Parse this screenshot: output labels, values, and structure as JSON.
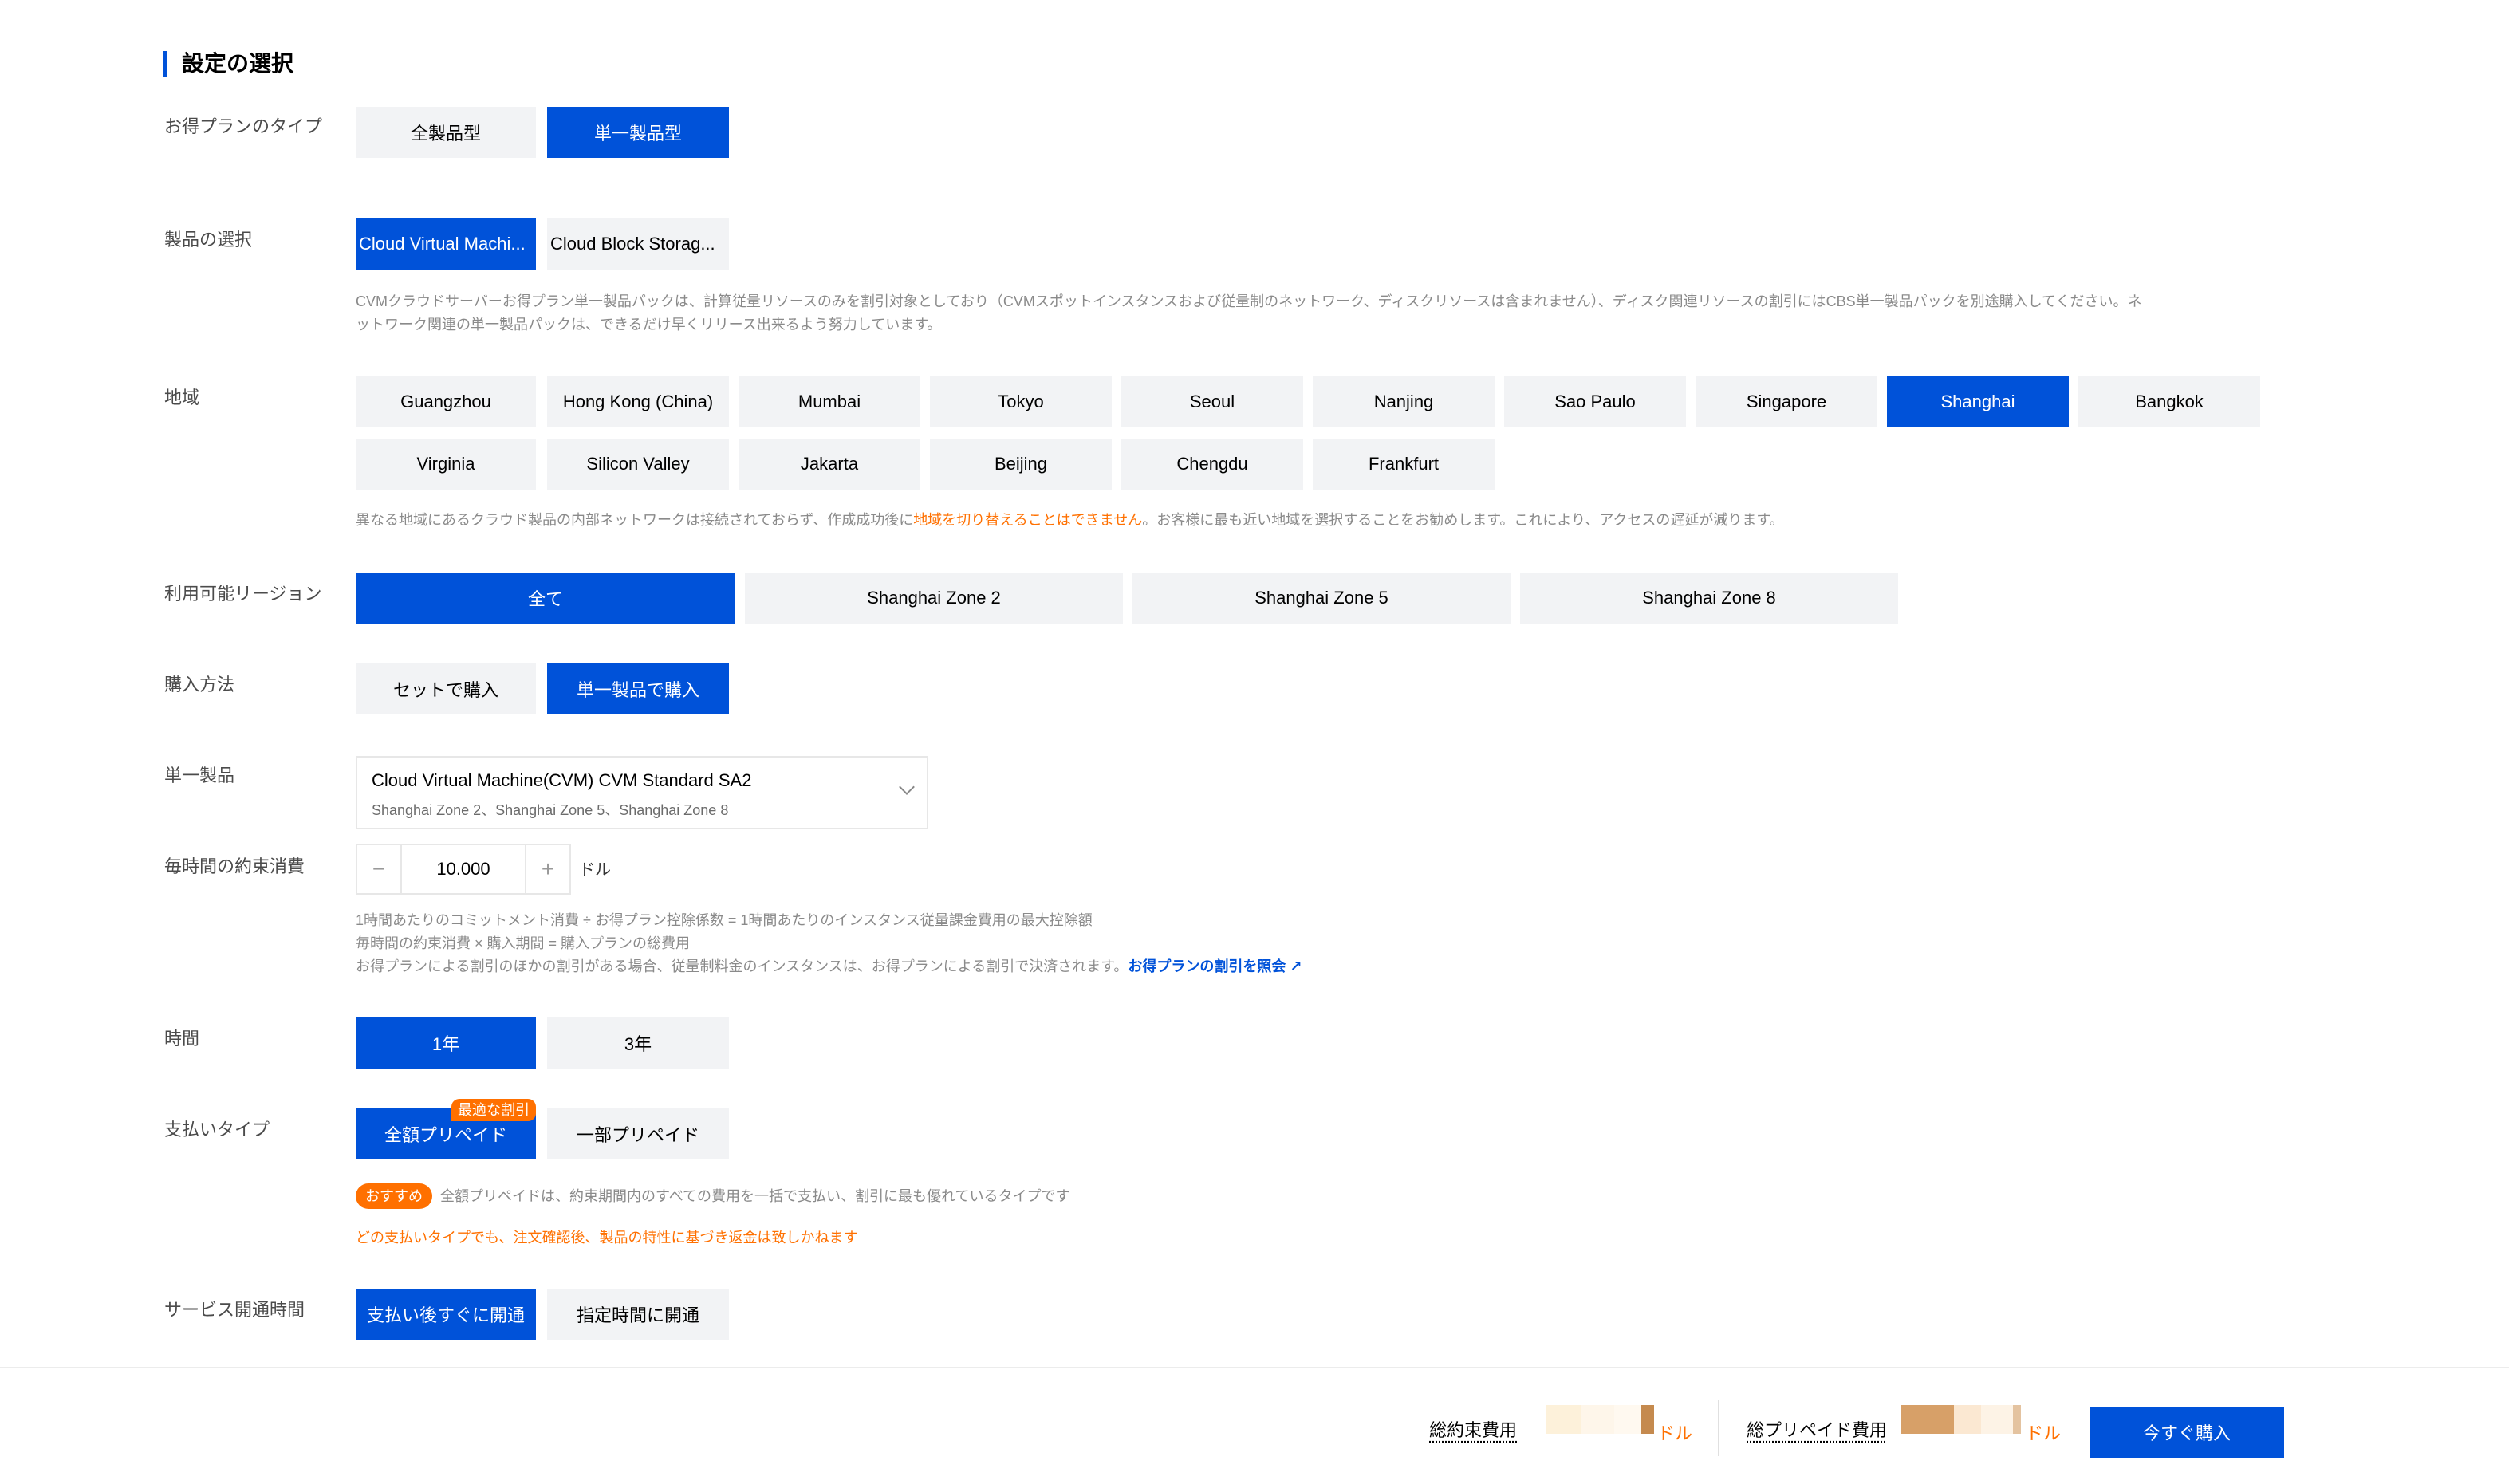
{
  "section": {
    "title": "設定の選択"
  },
  "plan_type": {
    "label": "お得プランのタイプ",
    "options": [
      "全製品型",
      "単一製品型"
    ],
    "selected": 1
  },
  "product": {
    "label": "製品の選択",
    "options": [
      "Cloud Virtual Machi...",
      "Cloud Block Storag..."
    ],
    "selected": 0,
    "note_line1": "CVMクラウドサーバーお得プラン単一製品パックは、計算従量リソースのみを割引対象としており（CVMスポットインスタンスおよび従量制のネットワーク、ディスクリソースは含まれません）、ディスク関連リソースの割引にはCBS単一製品パックを別途購入してください。ネ",
    "note_line2": "ットワーク関連の単一製品パックは、できるだけ早くリリース出来るよう努力しています。"
  },
  "region": {
    "label": "地域",
    "options": [
      "Guangzhou",
      "Hong Kong (China)",
      "Mumbai",
      "Tokyo",
      "Seoul",
      "Nanjing",
      "Sao Paulo",
      "Singapore",
      "Shanghai",
      "Bangkok",
      "Virginia",
      "Silicon Valley",
      "Jakarta",
      "Beijing",
      "Chengdu",
      "Frankfurt"
    ],
    "selected": 8,
    "note_pre": "異なる地域にあるクラウド製品の内部ネットワークは接続されておらず、作成成功後に",
    "note_highlight": "地域を切り替えることはできません",
    "note_post": "。お客様に最も近い地域を選択することをお勧めします。これにより、アクセスの遅延が減ります。"
  },
  "zone": {
    "label": "利用可能リージョン",
    "options": [
      "全て",
      "Shanghai Zone 2",
      "Shanghai Zone 5",
      "Shanghai Zone 8"
    ],
    "selected": 0
  },
  "purchase_method": {
    "label": "購入方法",
    "options": [
      "セットで購入",
      "単一製品で購入"
    ],
    "selected": 1
  },
  "single_product": {
    "label": "単一製品",
    "value": "Cloud Virtual Machine(CVM) CVM Standard SA2",
    "sub": "Shanghai Zone 2、Shanghai Zone 5、Shanghai Zone 8"
  },
  "hourly": {
    "label": "毎時間の約束消費",
    "minus": "−",
    "value": "10.000",
    "plus": "+",
    "unit": "ドル",
    "note_line1": "1時間あたりのコミットメント消費 ÷ お得プラン控除係数 = 1時間あたりのインスタンス従量課金費用の最大控除額",
    "note_line2": "毎時間の約束消費 × 購入期間 = 購入プランの総費用",
    "note_line3": "お得プランによる割引のほかの割引がある場合、従量制料金のインスタンスは、お得プランによる割引で決済されます。",
    "note_link": "お得プランの割引を照会"
  },
  "duration": {
    "label": "時間",
    "options": [
      "1年",
      "3年"
    ],
    "selected": 0
  },
  "payment": {
    "label": "支払いタイプ",
    "options": [
      "全額プリペイド",
      "一部プリペイド"
    ],
    "selected": 0,
    "best_badge": "最適な割引",
    "recommend_pill": "おすすめ",
    "recommend_text": "全額プリペイドは、約束期間内のすべての費用を一括で支払い、割引に最も優れているタイプです",
    "warning": "どの支払いタイプでも、注文確認後、製品の特性に基づき返金は致しかねます"
  },
  "activation": {
    "label": "サービス開通時間",
    "options": [
      "支払い後すぐに開通",
      "指定時間に開通"
    ],
    "selected": 0
  },
  "footer": {
    "total_commit_label": "総約束費用",
    "total_prepaid_label": "総プリペイド費用",
    "unit": "ドル",
    "buy_label": "今すぐ購入"
  },
  "colors": {
    "primary": "#0052d9",
    "accent": "#ff7000",
    "button_bg": "#f2f3f5"
  }
}
